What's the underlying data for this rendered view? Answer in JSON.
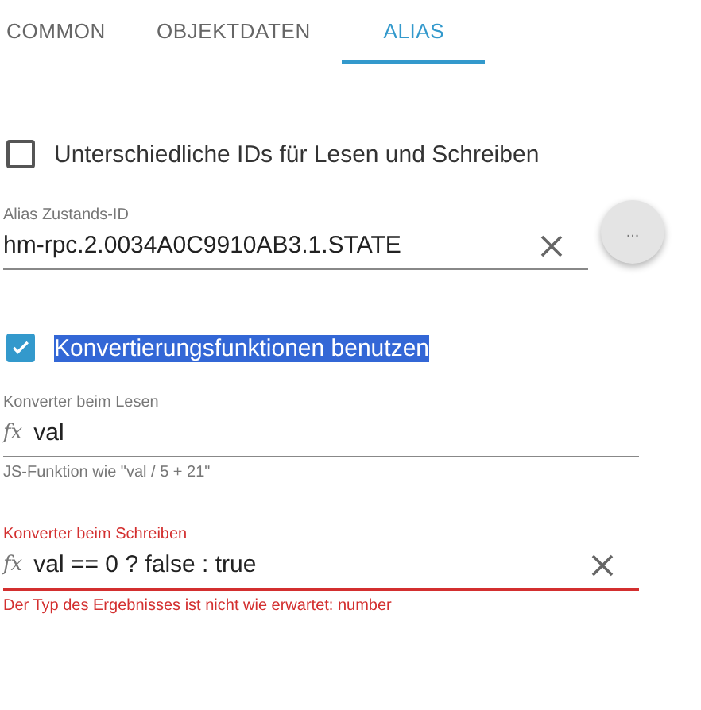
{
  "tabs": [
    {
      "label": "COMMON",
      "selected": false
    },
    {
      "label": "OBJEKTDATEN",
      "selected": false
    },
    {
      "label": "ALIAS",
      "selected": true
    }
  ],
  "separate_ids": {
    "label": "Unterschiedliche IDs für Lesen und Schreiben",
    "checked": false
  },
  "alias_id": {
    "label": "Alias Zustands-ID",
    "value": "hm-rpc.2.0034A0C9910AB3.1.STATE",
    "browse_button": "..."
  },
  "use_conversion": {
    "label": "Konvertierungsfunktionen benutzen",
    "checked": true,
    "highlighted": true
  },
  "read_converter": {
    "label": "Konverter beim Lesen",
    "prefix": "fx",
    "value": "val",
    "helper": "JS-Funktion wie \"val / 5 + 21\"",
    "invalid": false,
    "clearable": false
  },
  "write_converter": {
    "label": "Konverter beim Schreiben",
    "prefix": "fx",
    "value": "val == 0 ? false : true",
    "helper": "Der Typ des Ergebnisses ist nicht wie erwartet: number",
    "invalid": true,
    "clearable": true
  }
}
